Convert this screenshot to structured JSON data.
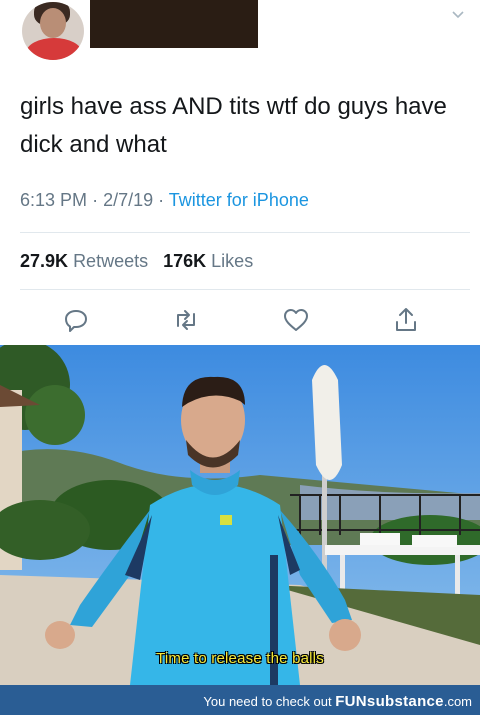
{
  "tweet": {
    "text": "girls have ass AND tits wtf do guys have dick and what",
    "time": "6:13 PM",
    "date": "2/7/19",
    "source": "Twitter for iPhone",
    "retweets_count": "27.9K",
    "retweets_label": "Retweets",
    "likes_count": "176K",
    "likes_label": "Likes"
  },
  "icons": {
    "reply": "reply-icon",
    "retweet": "retweet-icon",
    "like": "heart-icon",
    "share": "share-icon",
    "more": "chevron-down-icon"
  },
  "image": {
    "subtitle": "Time to release the balls"
  },
  "footer": {
    "message": "You need to check out",
    "brand": "FUNsubstance",
    "domain": ".com"
  },
  "colors": {
    "link_blue": "#1b95e0",
    "meta_gray": "#657786",
    "subtitle_yellow": "#f7e93a",
    "footer_bg": "#2a5d94"
  }
}
